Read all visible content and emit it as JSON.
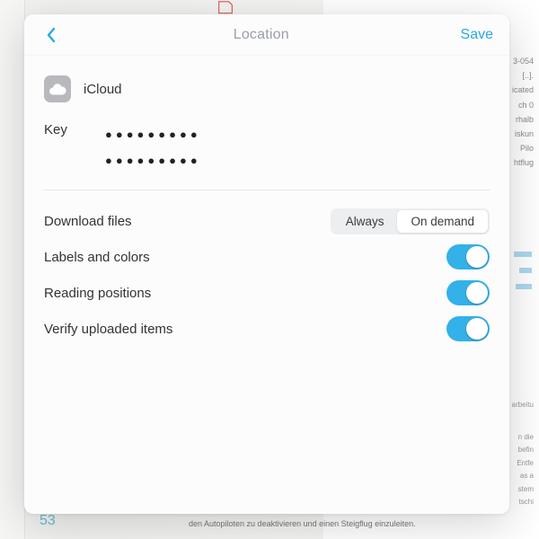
{
  "background": {
    "page_number": "53",
    "caption": "den Autopiloten zu deaktivieren und einen Steigflug einzuleiten.",
    "right_fragments": [
      "3-054",
      "[..].",
      "icated",
      "ch 0",
      "rhalb",
      "iskun",
      "Pilo",
      "htflug"
    ],
    "bars": [
      "38.67",
      "78.48",
      "78.45"
    ],
    "arbeit_label": "arbeitu",
    "para_fragments": [
      "n die",
      "befin",
      "Entfe",
      "as a",
      "stem",
      "tschi"
    ]
  },
  "modal": {
    "title": "Location",
    "save_label": "Save",
    "provider": {
      "name": "iCloud"
    },
    "key": {
      "label": "Key",
      "line1": "●●●●●●●●●",
      "line2": "●●●●●●●●●"
    },
    "settings": {
      "download": {
        "label": "Download files",
        "options": [
          "Always",
          "On demand"
        ],
        "selected": 1
      },
      "labels_colors": {
        "label": "Labels and colors",
        "on": true
      },
      "reading_positions": {
        "label": "Reading positions",
        "on": true
      },
      "verify_uploaded": {
        "label": "Verify uploaded items",
        "on": true
      }
    }
  }
}
